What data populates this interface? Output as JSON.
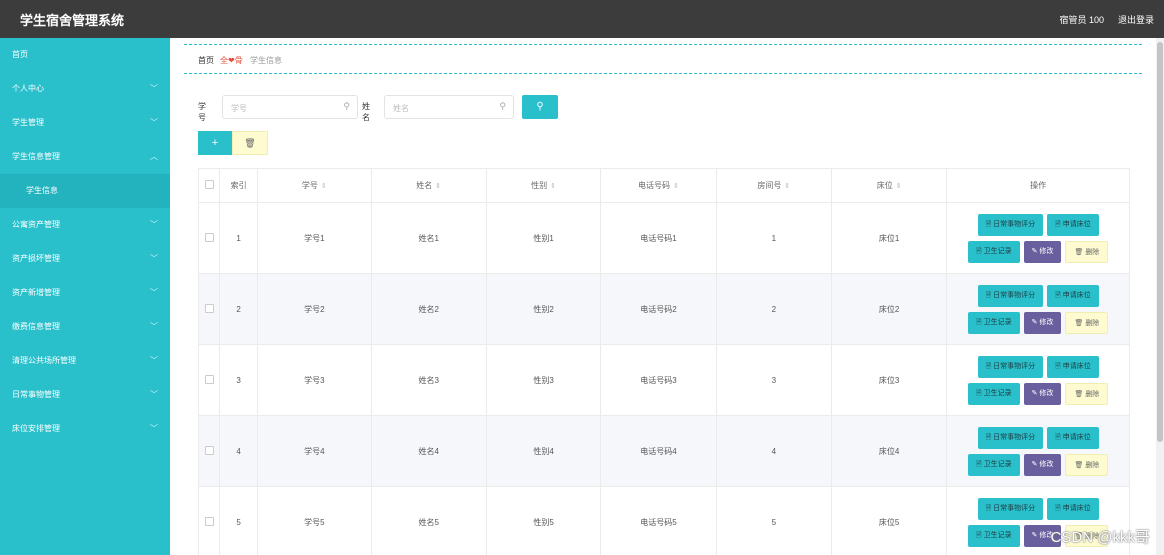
{
  "header": {
    "title": "学生宿舍管理系统",
    "user": "宿管员 100",
    "logout": "退出登录"
  },
  "sidebar": {
    "items": [
      {
        "label": "首页",
        "chevron": ""
      },
      {
        "label": "个人中心",
        "chevron": "﹀"
      },
      {
        "label": "学生管理",
        "chevron": "﹀"
      },
      {
        "label": "学生信息管理",
        "chevron": "︿"
      },
      {
        "label": "学生信息",
        "chevron": ""
      },
      {
        "label": "公寓资产管理",
        "chevron": "﹀"
      },
      {
        "label": "资产损坏管理",
        "chevron": "﹀"
      },
      {
        "label": "资产新增管理",
        "chevron": "﹀"
      },
      {
        "label": "缴费信息管理",
        "chevron": "﹀"
      },
      {
        "label": "清理公共场所管理",
        "chevron": "﹀"
      },
      {
        "label": "日常事物管理",
        "chevron": "﹀"
      },
      {
        "label": "床位安排管理",
        "chevron": "﹀"
      }
    ]
  },
  "breadcrumb": {
    "home": "首页",
    "separator": "全❤骨",
    "current": "学生信息"
  },
  "search": {
    "label1": "学号",
    "placeholder1": "学号",
    "label2": "姓名",
    "placeholder2": "姓名",
    "search_icon": "search-icon"
  },
  "actions": {
    "add_label": "+",
    "delete_label": "🗑"
  },
  "table": {
    "headers": [
      "索引",
      "学号",
      "姓名",
      "性别",
      "电话号码",
      "房间号",
      "床位",
      "操作"
    ],
    "sort_icon": "⇕",
    "rows": [
      {
        "index": "1",
        "xh": "学号1",
        "xm": "姓名1",
        "xb": "性别1",
        "dh": "电话号码1",
        "fj": "1",
        "cw": "床位1"
      },
      {
        "index": "2",
        "xh": "学号2",
        "xm": "姓名2",
        "xb": "性别2",
        "dh": "电话号码2",
        "fj": "2",
        "cw": "床位2"
      },
      {
        "index": "3",
        "xh": "学号3",
        "xm": "姓名3",
        "xb": "性别3",
        "dh": "电话号码3",
        "fj": "3",
        "cw": "床位3"
      },
      {
        "index": "4",
        "xh": "学号4",
        "xm": "姓名4",
        "xb": "性别4",
        "dh": "电话号码4",
        "fj": "4",
        "cw": "床位4"
      },
      {
        "index": "5",
        "xh": "学号5",
        "xm": "姓名5",
        "xb": "性别5",
        "dh": "电话号码5",
        "fj": "5",
        "cw": "床位5"
      }
    ],
    "ops": {
      "daily": "🗎 日常事物评分",
      "apply_bed": "🗎 申请床位",
      "hygiene": "🗎 卫生记录",
      "edit": "✎ 修改",
      "remove": "🗑 删除"
    }
  },
  "watermark": "CSDN @kkk哥",
  "colors": {
    "accent": "#29c0cc",
    "header": "#3c3c3c",
    "purple": "#6a5f9e",
    "yellow": "#fdfbcf"
  }
}
